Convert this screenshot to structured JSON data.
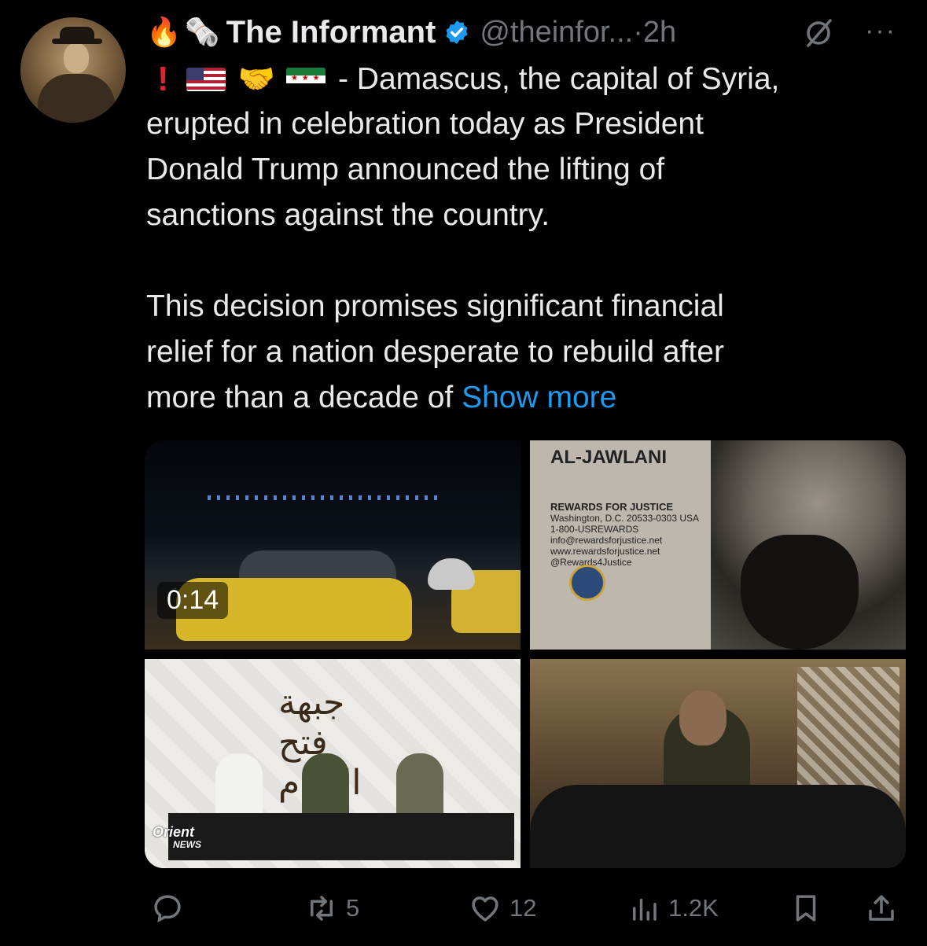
{
  "tweet": {
    "author_name": "The Informant",
    "handle": "@theinfor...",
    "dot": " · ",
    "time": "2h",
    "more_label": "···",
    "lead_emojis": [
      "🔥",
      "🗞️"
    ],
    "flag_row_emojis": [
      "❗",
      "🇺🇸",
      "🤝",
      "🇸🇾"
    ],
    "line1_rest": "- Damascus, the capital of Syria,",
    "body_lines": [
      "erupted in celebration today as President",
      "Donald Trump announced the lifting of",
      "sanctions against the country."
    ],
    "para2_lines": [
      "This decision promises significant financial",
      "relief for a nation desperate to rebuild after",
      "more than a decade of "
    ],
    "show_more": "Show more"
  },
  "media": {
    "video_duration": "0:14",
    "wanted_name": "AL-JAWLANI",
    "rfj_title": "REWARDS FOR JUSTICE",
    "rfj_lines": [
      "Washington, D.C. 20533-0303 USA",
      "1-800-USREWARDS",
      "info@rewardsforjustice.net",
      "www.rewardsforjustice.net",
      "@Rewards4Justice"
    ],
    "banner_calligraphy": "جبهة فتح الشام",
    "orient_logo": "Orient",
    "orient_sub": "NEWS"
  },
  "actions": {
    "reply": {
      "icon": "reply-icon",
      "count": ""
    },
    "repost": {
      "icon": "repost-icon",
      "count": "5"
    },
    "like": {
      "icon": "heart-icon",
      "count": "12"
    },
    "views": {
      "icon": "views-icon",
      "count": "1.2K"
    },
    "bookmark": {
      "icon": "bookmark-icon"
    },
    "share": {
      "icon": "share-icon"
    }
  },
  "colors": {
    "background": "#000000",
    "text": "#e7e9ea",
    "muted": "#71767b",
    "link": "#1d9bf0",
    "verified": "#1d9bf0"
  }
}
